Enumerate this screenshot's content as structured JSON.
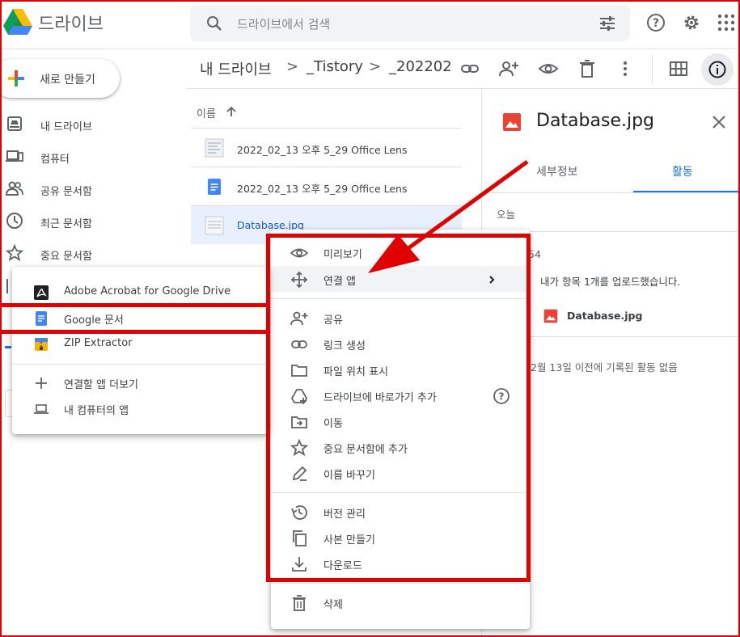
{
  "header": {
    "app_name": "드라이브",
    "search_placeholder": "드라이브에서 검색"
  },
  "sidebar": {
    "new_button": "새로 만들기",
    "items": [
      {
        "label": "내 드라이브",
        "icon": "my-drive-icon"
      },
      {
        "label": "컴퓨터",
        "icon": "computer-icon"
      },
      {
        "label": "공유 문서함",
        "icon": "shared-icon"
      },
      {
        "label": "최근 문서함",
        "icon": "recent-icon"
      },
      {
        "label": "중요 문서함",
        "icon": "star-icon"
      }
    ]
  },
  "breadcrumb": {
    "root": "내 드라이브",
    "sep": ">",
    "folder1": "_Tistory",
    "folder2": "_202202"
  },
  "file_list": {
    "column_name": "이름",
    "files": [
      {
        "name": "2022_02_13 오후 5_29 Office Lens",
        "type": "image"
      },
      {
        "name": "2022_02_13 오후 5_29 Office Lens",
        "type": "doc"
      },
      {
        "name": "Database.jpg",
        "type": "image",
        "selected": true
      }
    ]
  },
  "details_panel": {
    "title": "Database.jpg",
    "tab_details": "세부정보",
    "tab_activity": "활동",
    "today": "오늘",
    "time_partial": "54",
    "activity_text": "내가 항목 1개를 업로드했습니다.",
    "activity_file": "Database.jpg",
    "no_activity": "2월 13일 이전에 기록된 활동 없음"
  },
  "context_menu": {
    "items": [
      {
        "label": "미리보기",
        "icon": "eye-icon"
      },
      {
        "label": "연결 앱",
        "icon": "move-arrows-icon",
        "submenu": true
      },
      {
        "label": "공유",
        "icon": "add-person-icon"
      },
      {
        "label": "링크 생성",
        "icon": "link-icon"
      },
      {
        "label": "파일 위치 표시",
        "icon": "folder-icon"
      },
      {
        "label": "드라이브에 바로가기 추가",
        "icon": "add-shortcut-icon"
      },
      {
        "label": "이동",
        "icon": "move-to-icon"
      },
      {
        "label": "중요 문서함에 추가",
        "icon": "star-icon"
      },
      {
        "label": "이름 바꾸기",
        "icon": "pencil-icon"
      },
      {
        "label": "버전 관리",
        "icon": "history-icon"
      },
      {
        "label": "사본 만들기",
        "icon": "copy-icon"
      },
      {
        "label": "다운로드",
        "icon": "download-icon"
      },
      {
        "label": "삭제",
        "icon": "trash-icon"
      }
    ]
  },
  "open_with_submenu": {
    "items": [
      {
        "label": "Adobe Acrobat for Google Drive",
        "icon": "acrobat-icon"
      },
      {
        "label": "Google 문서",
        "icon": "google-docs-icon"
      },
      {
        "label": "ZIP Extractor",
        "icon": "zip-icon"
      },
      {
        "label": "연결할 앱 더보기",
        "icon": "plus-icon"
      },
      {
        "label": "내 컴퓨터의 앱",
        "icon": "laptop-icon"
      }
    ]
  },
  "colors": {
    "accent": "#1a73e8",
    "highlight": "#e00000",
    "selected_row": "#e8f0fe"
  }
}
